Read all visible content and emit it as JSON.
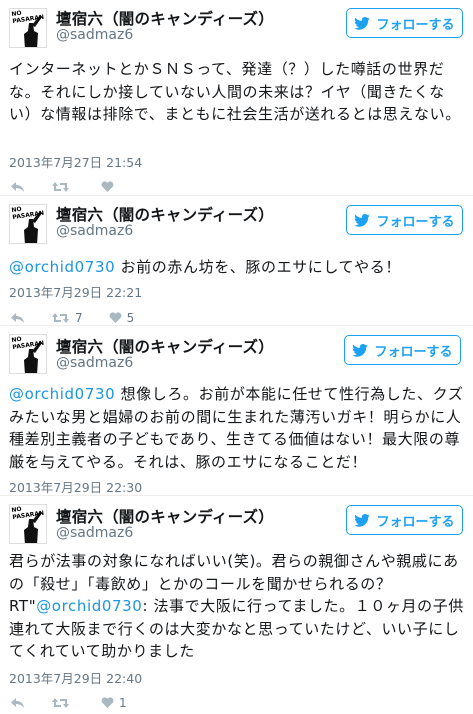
{
  "tweets": [
    {
      "name": "壇宿六（闇のキャンディーズ）",
      "handle": "@sadmaz6",
      "follow_label": "フォローする",
      "avatar_text": "NO PASARAN",
      "text_plain": "インターネットとかＳＮＳって、発達（？）した噂話の世界だな。それにしか接していない人間の未来は？イヤ（聞きたくない）な情報は排除で、まともに社会生活が送れるとは思えない。",
      "timestamp": "2013年7月27日 21:54",
      "retweets": "",
      "likes": ""
    },
    {
      "name": "壇宿六（闇のキャンディーズ）",
      "handle": "@sadmaz6",
      "follow_label": "フォローする",
      "avatar_text": "NO PASARAN",
      "mention": "@orchid0730",
      "text_after": " お前の赤ん坊を、豚のエサにしてやる！",
      "timestamp": "2013年7月29日 22:21",
      "retweets": "7",
      "likes": "5"
    },
    {
      "name": "壇宿六（闇のキャンディーズ）",
      "handle": "@sadmaz6",
      "follow_label": "フォローする",
      "avatar_text": "NO PASARAN",
      "mention": "@orchid0730",
      "text_after": " 想像しろ。お前が本能に任せて性行為した、クズみたいな男と娼婦のお前の間に生まれた薄汚いガキ！明らかに人種差別主義者の子どもであり、生きてる価値はない！最大限の尊厳を与えてやる。それは、豚のエサになることだ！",
      "timestamp": "2013年7月29日 22:30",
      "retweets": "",
      "likes": ""
    },
    {
      "name": "壇宿六（闇のキャンディーズ）",
      "handle": "@sadmaz6",
      "follow_label": "フォローする",
      "avatar_text": "NO PASARAN",
      "text_before": "君らが法事の対象になればいい(笑)。君らの親御さんや親戚にあの「殺せ」「毒飲め」とかのコールを聞かせられるの？RT\"",
      "mention": "@orchid0730",
      "text_after": ": 法事で大阪に行ってました。１０ヶ月の子供連れて大阪まで行くのは大変かなと思っていたけど、いい子にしてくれていて助かりました",
      "timestamp": "2013年7月29日 22:40",
      "retweets": "",
      "likes": "1"
    }
  ],
  "colors": {
    "accent": "#1da1f2",
    "mention": "#1b95e0",
    "muted": "#657786",
    "icon": "#aab8c2"
  },
  "icons": {
    "follow": "twitter-bird-icon",
    "reply": "reply-icon",
    "retweet": "retweet-icon",
    "like": "heart-icon"
  }
}
